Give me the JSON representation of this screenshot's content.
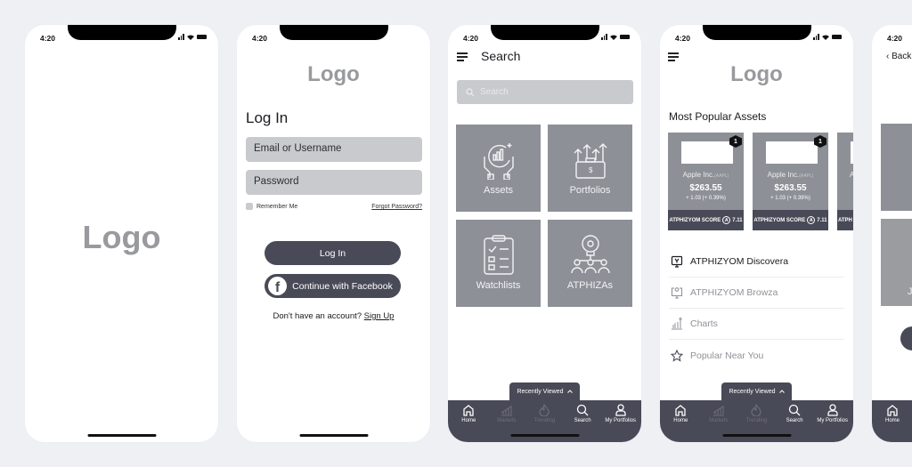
{
  "status_bar": {
    "time": "4:20"
  },
  "splash": {
    "logo": "Logo"
  },
  "login": {
    "logo": "Logo",
    "title": "Log In",
    "email_placeholder": "Email or Username",
    "password_placeholder": "Password",
    "remember_label": "Remember Me",
    "forgot_label": "Forgot Password?",
    "login_button": "Log In",
    "facebook_button": "Continue with Facebook",
    "facebook_icon": "f",
    "no_account_text": "Don't have an account?",
    "signup_link": "Sign Up"
  },
  "search": {
    "title": "Search",
    "placeholder": "Search",
    "tiles": [
      {
        "label": "Assets",
        "icon": "hands-chart-icon"
      },
      {
        "label": "Portfolios",
        "icon": "briefcase-arrows-icon"
      },
      {
        "label": "Watchlists",
        "icon": "clipboard-checklist-icon"
      },
      {
        "label": "ATPHIZAs",
        "icon": "lightbulb-people-icon"
      }
    ]
  },
  "recently_viewed": {
    "label": "Recently Viewed",
    "icon": "chevron-up-icon"
  },
  "tabbar": {
    "items": [
      {
        "label": "Home",
        "icon": "home-icon",
        "active": true
      },
      {
        "label": "Markets",
        "icon": "markets-icon",
        "active": false
      },
      {
        "label": "Trending",
        "icon": "flame-icon",
        "active": false
      },
      {
        "label": "Search",
        "icon": "search-icon",
        "active": true
      },
      {
        "label": "My Portfolios",
        "icon": "user-icon",
        "active": true
      }
    ]
  },
  "home": {
    "logo": "Logo",
    "section_title": "Most Popular Assets",
    "cards": [
      {
        "rank": "1",
        "name": "Apple Inc.",
        "ticker": "(AAPL)",
        "price": "$263.55",
        "change": "+ 1.03 (+ 0.39%)",
        "score_label": "ATPHIZYOM SCORE",
        "score_badge": "A",
        "score": "7.11"
      },
      {
        "rank": "1",
        "name": "Apple Inc.",
        "ticker": "(AAPL)",
        "price": "$263.55",
        "change": "+ 1.03 (+ 0.39%)",
        "score_label": "ATPHIZYOM SCORE",
        "score_badge": "A",
        "score": "7.11"
      },
      {
        "rank": "",
        "name": "A",
        "ticker": "",
        "price": "",
        "change": "",
        "score_label": "ATPH",
        "score_badge": "",
        "score": ""
      }
    ],
    "list": [
      {
        "label": "ATPHIZYOM Discovera",
        "icon": "monitor-y-icon",
        "active": true
      },
      {
        "label": "ATPHIZYOM Browza",
        "icon": "monitor-search-icon",
        "active": false
      },
      {
        "label": "Charts",
        "icon": "bar-chart-icon",
        "active": false
      },
      {
        "label": "Popular Near You",
        "icon": "star-icon",
        "active": false
      }
    ]
  },
  "detail": {
    "back_label": "Back",
    "tile_label": "J"
  }
}
